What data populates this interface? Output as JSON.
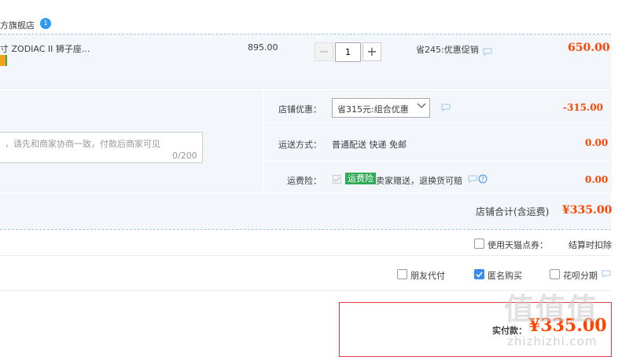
{
  "shop": {
    "name": "方旗舰店",
    "badge": "1"
  },
  "item": {
    "name": "ZODIAC II 狮子座...",
    "name_prefix": "寸",
    "unit_price": "895.00",
    "quantity": "1",
    "minus": "−",
    "plus": "+",
    "saving": "省245:优惠促销",
    "total": "650.00"
  },
  "message": {
    "placeholder": "，请先和商家协商一致，付款后商家可见",
    "count": "0/200"
  },
  "options": {
    "promo_label": "店铺优惠：",
    "promo_value": "省315元:组合优惠",
    "promo_amount": "-315.00",
    "shipping_label": "运送方式：",
    "shipping_value": "普通配送 快递 免邮",
    "shipping_amount": "0.00",
    "insurance_label": "运费险：",
    "insurance_tag": "运费险",
    "insurance_text": "卖家赠送，退换货可赔",
    "insurance_amount": "0.00"
  },
  "shop_total": {
    "label": "店铺合计(含运费)",
    "value": "¥335.00"
  },
  "extras": {
    "points_label": "使用天猫点券：",
    "points_note": "结算时扣除",
    "friend_pay": "朋友代付",
    "anonymous": "匿名购买",
    "huabei": "花呗分期"
  },
  "payment": {
    "label": "实付款：",
    "value": "¥335.00"
  },
  "watermark": {
    "main": "值值值",
    "sub": "zhizhizhi.com"
  },
  "colors": {
    "accent_red": "#ff4400",
    "panel_bg": "#f3f7fc",
    "check_blue": "#3b8cf1",
    "tag_green": "#2ea955"
  }
}
